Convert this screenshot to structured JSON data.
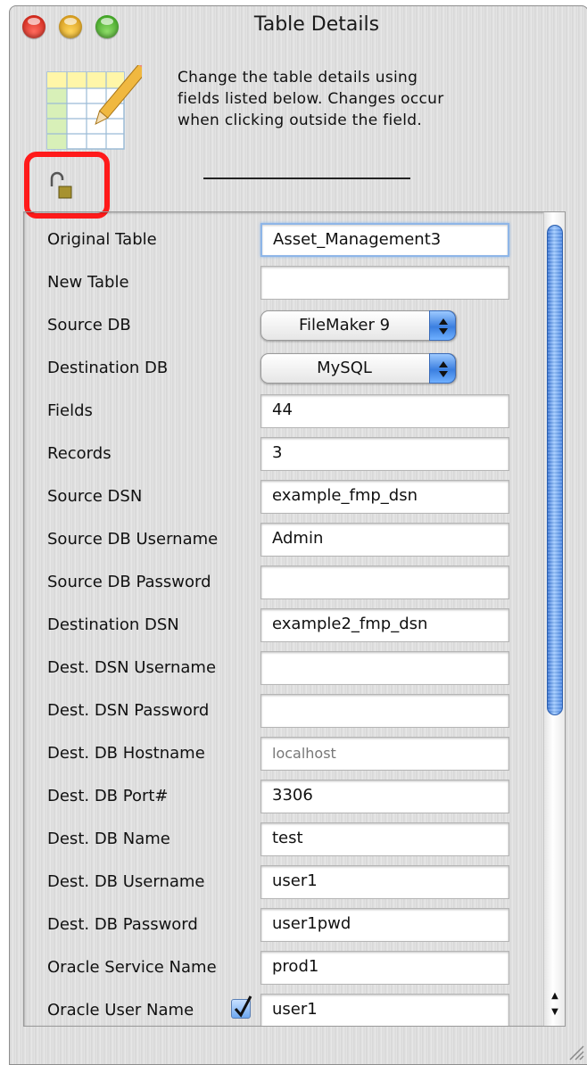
{
  "window": {
    "title": "Table Details",
    "instructions": "Change the table details using fields listed below. Changes occur when clicking outside the field."
  },
  "icons": {
    "app": "table-edit-icon",
    "lock": "unlocked-padlock-icon"
  },
  "colors": {
    "highlight": "#ff1a1a",
    "accent": "#3b7fe0"
  },
  "fields": [
    {
      "label": "Original Table",
      "value": "Asset_Management3",
      "type": "text",
      "focused": true
    },
    {
      "label": "New Table",
      "value": "",
      "type": "text"
    },
    {
      "label": "Source DB",
      "value": "FileMaker 9",
      "type": "select"
    },
    {
      "label": "Destination DB",
      "value": "MySQL",
      "type": "select"
    },
    {
      "label": "Fields",
      "value": "44",
      "type": "text"
    },
    {
      "label": "Records",
      "value": "3",
      "type": "text"
    },
    {
      "label": "Source DSN",
      "value": "example_fmp_dsn",
      "type": "text"
    },
    {
      "label": "Source DB Username",
      "value": "Admin",
      "type": "text"
    },
    {
      "label": "Source DB Password",
      "value": "",
      "type": "text"
    },
    {
      "label": "Destination DSN",
      "value": "example2_fmp_dsn",
      "type": "text"
    },
    {
      "label": "Dest. DSN Username",
      "value": "",
      "type": "text"
    },
    {
      "label": "Dest. DSN Password",
      "value": "",
      "type": "text"
    },
    {
      "label": "Dest. DB Hostname",
      "value": "",
      "placeholder": "localhost",
      "type": "text"
    },
    {
      "label": "Dest. DB Port#",
      "value": "3306",
      "type": "text"
    },
    {
      "label": "Dest. DB Name",
      "value": "test",
      "type": "text"
    },
    {
      "label": "Dest. DB Username",
      "value": "user1",
      "type": "text"
    },
    {
      "label": "Dest. DB Password",
      "value": "user1pwd",
      "type": "text"
    },
    {
      "label": "Oracle Service Name",
      "value": "prod1",
      "type": "text"
    },
    {
      "label": "Oracle User Name",
      "value": "user1",
      "type": "text",
      "checkbox": true,
      "checked": true
    }
  ]
}
